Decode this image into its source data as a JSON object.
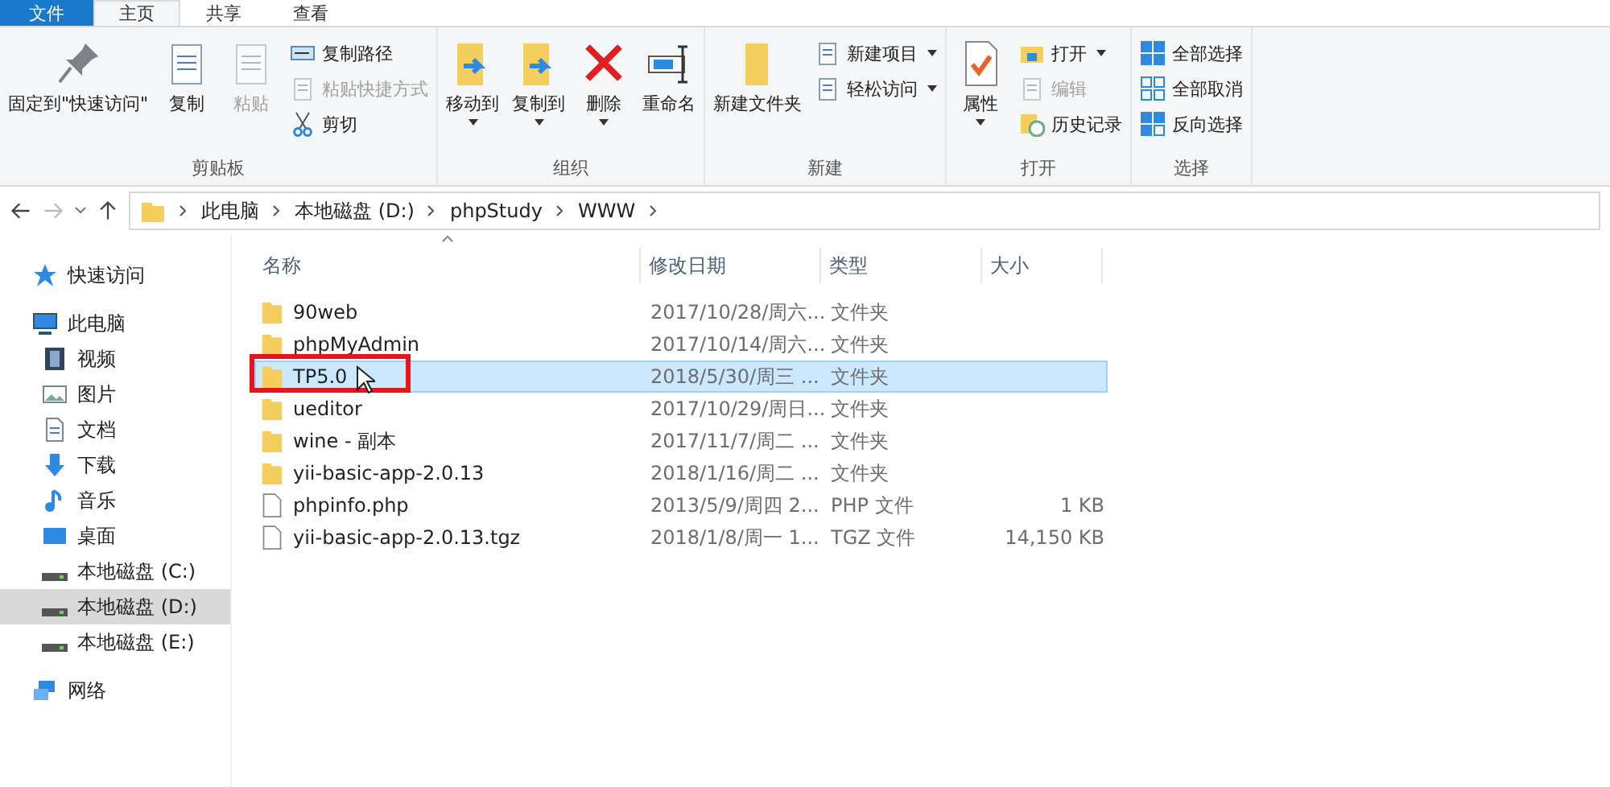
{
  "ribbon_tabs": [
    {
      "label": "文件",
      "kind": "file",
      "selected": false
    },
    {
      "label": "主页",
      "kind": "tab",
      "selected": true
    },
    {
      "label": "共享",
      "kind": "tab",
      "selected": false
    },
    {
      "label": "查看",
      "kind": "tab",
      "selected": false
    }
  ],
  "ribbon_groups": [
    {
      "label": "剪贴板",
      "items": [
        {
          "kind": "large",
          "label": "固定到\"快速访问\"",
          "disabled": false,
          "dropdown": false
        },
        {
          "kind": "large",
          "label": "复制",
          "disabled": false,
          "dropdown": false
        },
        {
          "kind": "large",
          "label": "粘贴",
          "disabled": true,
          "dropdown": false
        },
        {
          "kind": "small",
          "label": "复制路径",
          "disabled": false,
          "dropdown": false
        },
        {
          "kind": "small",
          "label": "粘贴快捷方式",
          "disabled": true,
          "dropdown": false
        },
        {
          "kind": "small",
          "label": "剪切",
          "disabled": false,
          "dropdown": false
        }
      ]
    },
    {
      "label": "组织",
      "items": [
        {
          "kind": "large",
          "label": "移动到",
          "disabled": false,
          "dropdown": true
        },
        {
          "kind": "large",
          "label": "复制到",
          "disabled": false,
          "dropdown": true
        },
        {
          "kind": "large",
          "label": "删除",
          "disabled": false,
          "dropdown": true
        },
        {
          "kind": "large",
          "label": "重命名",
          "disabled": false,
          "dropdown": false
        }
      ]
    },
    {
      "label": "新建",
      "items": [
        {
          "kind": "large",
          "label": "新建文件夹",
          "disabled": false,
          "dropdown": false
        },
        {
          "kind": "small",
          "label": "新建项目",
          "disabled": false,
          "dropdown": true
        },
        {
          "kind": "small",
          "label": "轻松访问",
          "disabled": false,
          "dropdown": true
        }
      ]
    },
    {
      "label": "打开",
      "items": [
        {
          "kind": "large",
          "label": "属性",
          "disabled": false,
          "dropdown": true
        },
        {
          "kind": "small",
          "label": "打开",
          "disabled": false,
          "dropdown": true
        },
        {
          "kind": "small",
          "label": "编辑",
          "disabled": true,
          "dropdown": false
        },
        {
          "kind": "small",
          "label": "历史记录",
          "disabled": false,
          "dropdown": false
        }
      ]
    },
    {
      "label": "选择",
      "items": [
        {
          "kind": "small",
          "label": "全部选择",
          "disabled": false,
          "dropdown": false
        },
        {
          "kind": "small",
          "label": "全部取消",
          "disabled": false,
          "dropdown": false
        },
        {
          "kind": "small",
          "label": "反向选择",
          "disabled": false,
          "dropdown": false
        }
      ]
    }
  ],
  "address": [
    "此电脑",
    "本地磁盘 (D:)",
    "phpStudy",
    "WWW"
  ],
  "nav": [
    {
      "label": "快速访问",
      "selected": false
    },
    {
      "label": "此电脑",
      "selected": false,
      "children": [
        {
          "label": "视频",
          "selected": false
        },
        {
          "label": "图片",
          "selected": false
        },
        {
          "label": "文档",
          "selected": false
        },
        {
          "label": "下载",
          "selected": false
        },
        {
          "label": "音乐",
          "selected": false
        },
        {
          "label": "桌面",
          "selected": false
        },
        {
          "label": "本地磁盘 (C:)",
          "selected": false
        },
        {
          "label": "本地磁盘 (D:)",
          "selected": true
        },
        {
          "label": "本地磁盘 (E:)",
          "selected": false
        }
      ]
    },
    {
      "label": "网络",
      "selected": false
    }
  ],
  "columns": [
    "名称",
    "修改日期",
    "类型",
    "大小"
  ],
  "rows": [
    {
      "kind": "folder",
      "name": "90web",
      "date": "2017/10/28/周六...",
      "type": "文件夹",
      "selected": false,
      "marked": false
    },
    {
      "kind": "folder",
      "name": "phpMyAdmin",
      "date": "2017/10/14/周六...",
      "type": "文件夹",
      "selected": false,
      "marked": false
    },
    {
      "kind": "folder",
      "name": "TP5.0",
      "date": "2018/5/30/周三 ...",
      "type": "文件夹",
      "selected": true,
      "marked": true
    },
    {
      "kind": "folder",
      "name": "ueditor",
      "date": "2017/10/29/周日...",
      "type": "文件夹",
      "selected": false,
      "marked": false
    },
    {
      "kind": "folder",
      "name": "wine - 副本",
      "date": "2017/11/7/周二 ...",
      "type": "文件夹",
      "selected": false,
      "marked": false
    },
    {
      "kind": "folder",
      "name": "yii-basic-app-2.0.13",
      "date": "2018/1/16/周二 ...",
      "type": "文件夹",
      "selected": false,
      "marked": false
    },
    {
      "kind": "file",
      "name": "phpinfo.php",
      "date": "2013/5/9/周四 2...",
      "type": "PHP 文件",
      "size": "1 KB",
      "selected": false,
      "marked": false
    },
    {
      "kind": "file",
      "name": "yii-basic-app-2.0.13.tgz",
      "date": "2018/1/8/周一 1...",
      "type": "TGZ 文件",
      "size": "14,150 KB",
      "selected": false,
      "marked": false
    }
  ]
}
